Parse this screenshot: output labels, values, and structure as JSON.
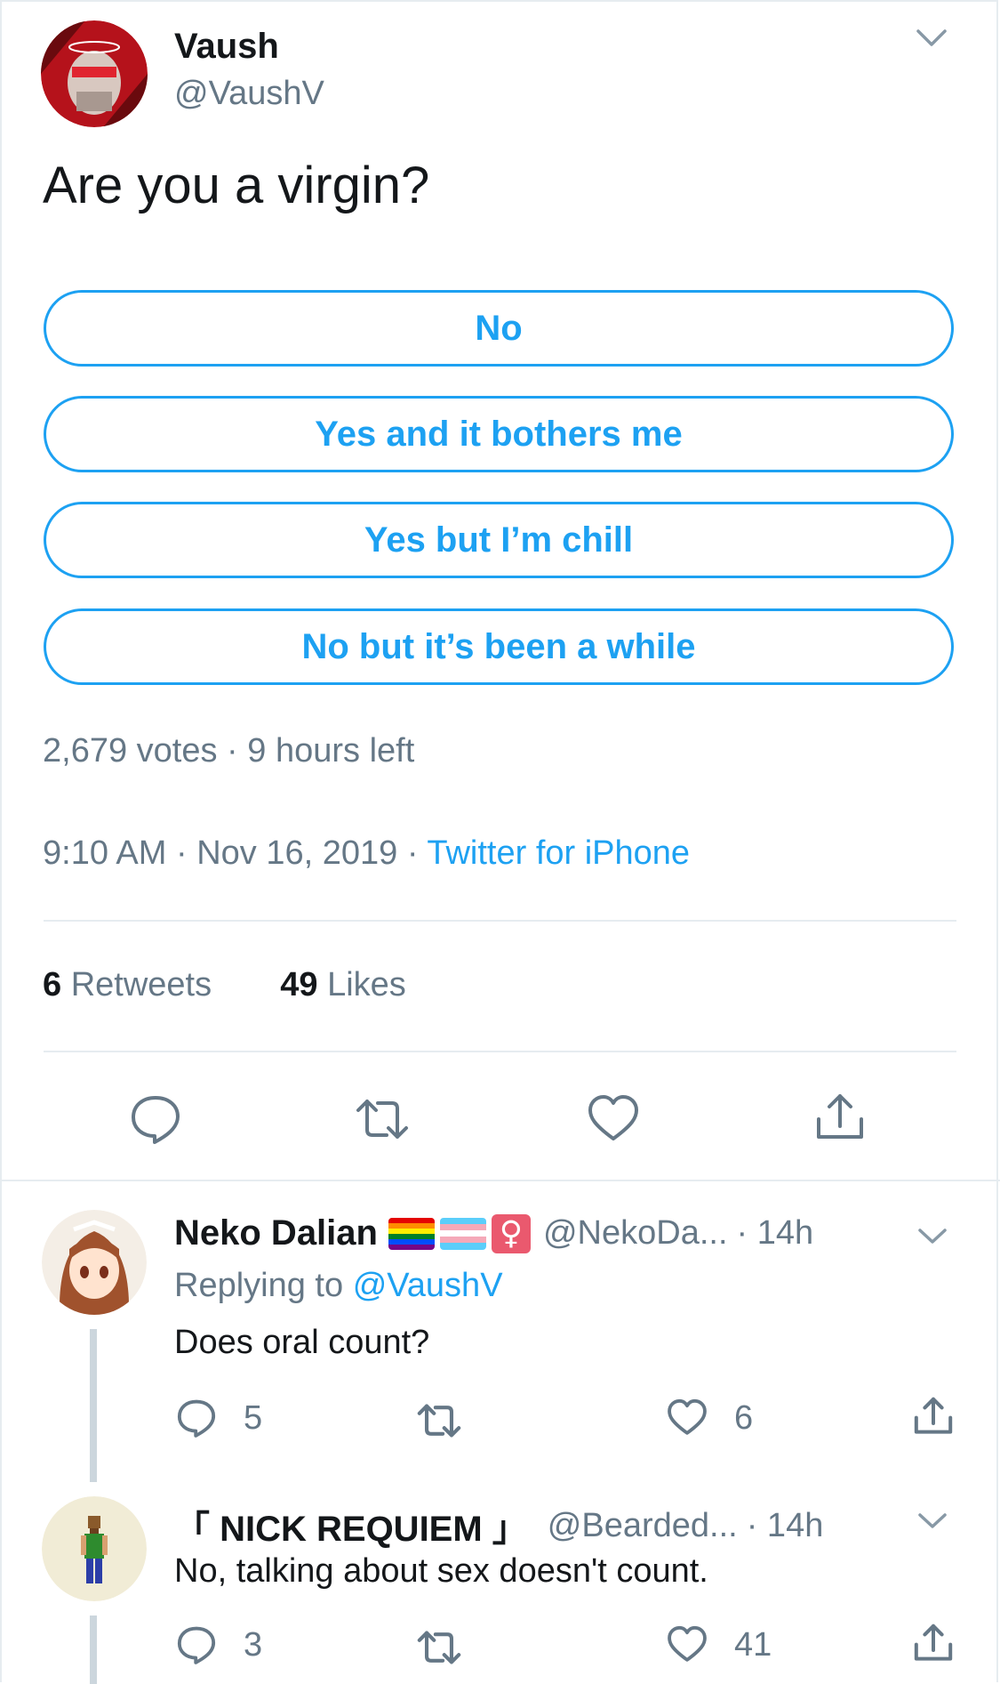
{
  "tweet": {
    "author_name": "Vaush",
    "author_handle": "@VaushV",
    "text": "Are you a virgin?",
    "poll": {
      "options": [
        "No",
        "Yes and it bothers me",
        "Yes but I’m chill",
        "No but it’s been a while"
      ],
      "votes": "2,679 votes",
      "separator": "·",
      "time_left": "9 hours left"
    },
    "time": "9:10 AM",
    "date": "Nov 16, 2019",
    "source": "Twitter for iPhone",
    "dot": "·",
    "retweets_count": "6",
    "retweets_label": "Retweets",
    "likes_count": "49",
    "likes_label": "Likes"
  },
  "replies": [
    {
      "name": "Neko Dalian",
      "badges": [
        "rainbow-flag-icon",
        "trans-flag-icon",
        "female-sign-icon"
      ],
      "female_symbol": "♀",
      "handle": "@NekoDa...",
      "time": "· 14h",
      "replying_prefix": "Replying to",
      "replying_to": "@VaushV",
      "text": "Does oral count?",
      "reply_count": "5",
      "retweet_count": "",
      "like_count": "6"
    },
    {
      "name": "「 NICK REQUIEM 」",
      "handle": "@Bearded...",
      "time": "· 14h",
      "text": "No, talking about sex doesn't count.",
      "reply_count": "3",
      "retweet_count": "",
      "like_count": "41"
    }
  ],
  "colors": {
    "accent": "#1da1f2",
    "secondary_text": "#657786",
    "divider": "#e6ecf0",
    "thread_line": "#ccd6dd"
  },
  "icons": [
    "chevron-down-icon",
    "reply-icon",
    "retweet-icon",
    "like-icon",
    "share-icon"
  ]
}
